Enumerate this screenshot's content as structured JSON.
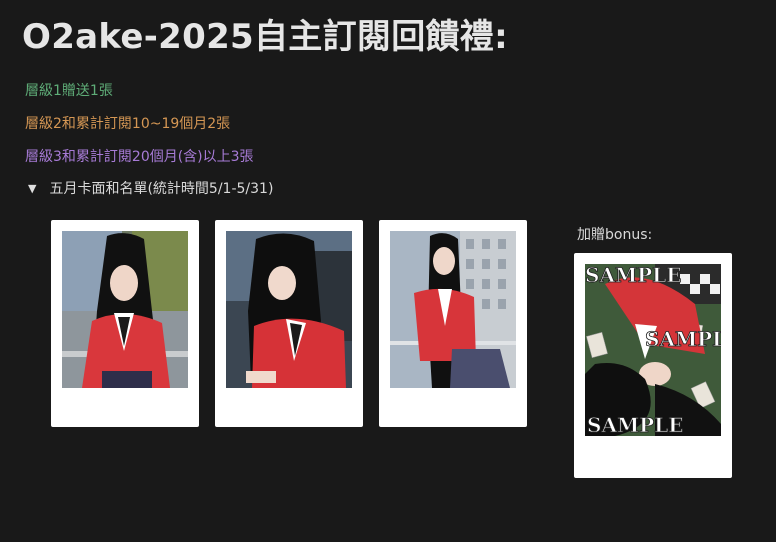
{
  "page": {
    "title": "O2ake-2025自主訂閱回饋禮:",
    "tiers": [
      {
        "label": "層級1贈送1張",
        "color": "#5fad78"
      },
      {
        "label": "層級2和累計訂閱10~19個月2張",
        "color": "#d59754"
      },
      {
        "label": "層級3和累計訂閱20個月(含)以上3張",
        "color": "#a77bd6"
      }
    ],
    "toggle": {
      "icon": "triangle-down-icon",
      "label": "五月卡面和名單(統計時間5/1-5/31)"
    },
    "bonus": {
      "label": "加贈bonus:",
      "watermarks": [
        "SAMPLE",
        "SAMPLE",
        "SAMPLE"
      ]
    }
  }
}
